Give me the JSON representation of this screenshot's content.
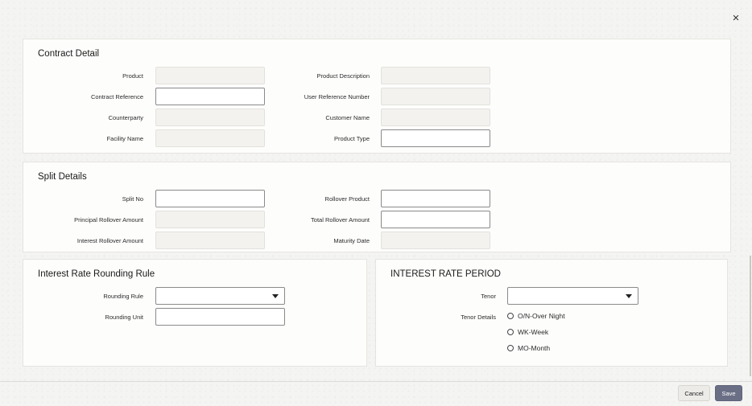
{
  "dialog": {
    "close_symbol": "×"
  },
  "contract_detail": {
    "title": "Contract Detail",
    "fields": {
      "product": {
        "label": "Product",
        "value": ""
      },
      "product_description": {
        "label": "Product Description",
        "value": ""
      },
      "contract_reference": {
        "label": "Contract Reference",
        "value": ""
      },
      "user_reference_number": {
        "label": "User Reference Number",
        "value": ""
      },
      "counterparty": {
        "label": "Counterparty",
        "value": ""
      },
      "customer_name": {
        "label": "Customer Name",
        "value": ""
      },
      "facility_name": {
        "label": "Facility Name",
        "value": ""
      },
      "product_type": {
        "label": "Product Type",
        "value": ""
      }
    }
  },
  "split_details": {
    "title": "Split Details",
    "fields": {
      "split_no": {
        "label": "Split No",
        "value": ""
      },
      "rollover_product": {
        "label": "Rollover Product",
        "value": ""
      },
      "principal_rollover_amount": {
        "label": "Principal Rollover Amount",
        "value": ""
      },
      "total_rollover_amount": {
        "label": "Total Rollover Amount",
        "value": ""
      },
      "interest_rollover_amount": {
        "label": "Interest Rollover Amount",
        "value": ""
      },
      "maturity_date": {
        "label": "Maturity Date",
        "value": ""
      }
    }
  },
  "interest_rate_rounding_rule": {
    "title": "Interest Rate Rounding Rule",
    "rounding_rule": {
      "label": "Rounding Rule",
      "value": ""
    },
    "rounding_unit": {
      "label": "Rounding Unit",
      "value": ""
    }
  },
  "interest_rate_period": {
    "title": "INTEREST RATE PERIOD",
    "tenor": {
      "label": "Tenor",
      "value": ""
    },
    "tenor_details": {
      "label": "Tenor Details",
      "options": [
        "O/N-Over Night",
        "WK-Week",
        "MO-Month"
      ]
    }
  },
  "footer": {
    "cancel_label": "Cancel",
    "save_label": "Save"
  },
  "colors": {
    "save_button": "#6a6f86",
    "panel_bg": "#fdfdfc",
    "page_bg": "#f4f4f2"
  }
}
